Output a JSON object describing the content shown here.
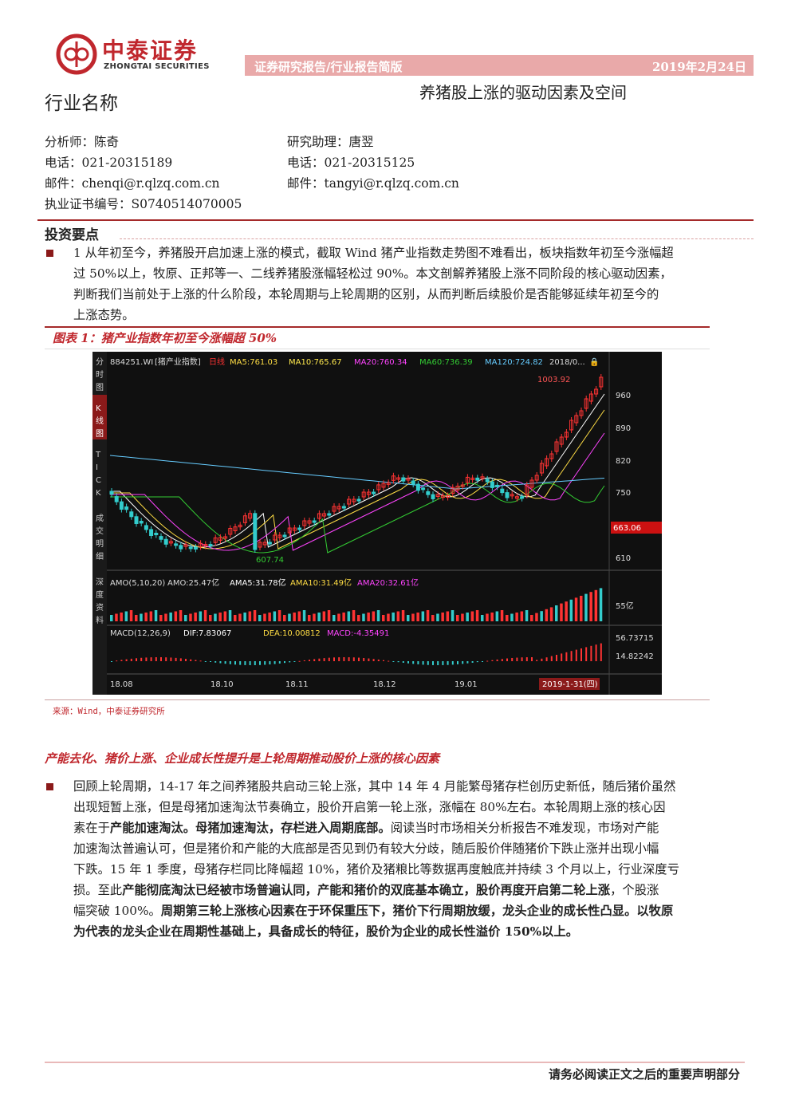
{
  "header": {
    "brand_cn": "中泰证券",
    "brand_en": "ZHONGTAI SECURITIES",
    "bar_left": "证券研究报告/行业报告简版",
    "bar_right": "2019年2月24日",
    "industry_name": "行业名称",
    "report_title": "养猪股上涨的驱动因素及空间"
  },
  "analysts": {
    "a1_name": "分析师：陈奇",
    "a1_phone": "电话：021-20315189",
    "a1_email": "邮件：chenqi@r.qlzq.com.cn",
    "a1_cert": "执业证书编号：S0740514070005",
    "a2_name": "研究助理：唐翌",
    "a2_phone": "电话：021-20315125",
    "a2_email": "邮件：tangyi@r.qlzq.com.cn"
  },
  "section": {
    "title": "投资要点"
  },
  "para1": {
    "l1": "1 从年初至今，养猪股开启加速上涨的模式，截取 Wind 猪产业指数走势图不难看出，板块指数年初至今涨幅超",
    "l2": "过 50%以上，牧原、正邦等一、二线养猪股涨幅轻松过 90%。本文剖解养猪股上涨不同阶段的核心驱动因素，",
    "l3": "判断我们当前处于上涨的什么阶段，本轮周期与上轮周期的区别，从而判断后续股价是否能够延续年初至今的",
    "l4": "上涨态势。"
  },
  "figure": {
    "title": "图表 1：猪产业指数年初至今涨幅超 50%",
    "source": "来源：Wind，中泰证券研究所"
  },
  "chart_text": {
    "left_tabs": [
      "分时图",
      "K线图",
      "TICK",
      "成交明细",
      "深度资料"
    ],
    "code": "884251.WI",
    "name": "[猪产业指数]",
    "period": "日线",
    "ma5": "MA5:761.03",
    "ma10": "MA10:765.67",
    "ma20": "MA20:760.34",
    "ma60": "MA60:736.39",
    "ma120": "MA120:724.82",
    "date_tag": "2018/0...",
    "high_label": "1003.92",
    "low_label": "607.74",
    "price_axis": [
      "960",
      "890",
      "820",
      "750",
      "610"
    ],
    "current_price": "663.06",
    "amo_title": "AMO(5,10,20)",
    "amo": "AMO:25.47亿",
    "ama5": "AMA5:31.78亿",
    "ama10": "AMA10:31.49亿",
    "ama20": "AMA20:32.61亿",
    "amo_axis": "55亿",
    "macd_title": "MACD(12,26,9)",
    "dif": "DIF:7.83067",
    "dea": "DEA:10.00812",
    "macd": "MACD:-4.35491",
    "macd_axis": [
      "56.73715",
      "14.82242"
    ],
    "dates": [
      "18.08",
      "18.10",
      "18.11",
      "18.12",
      "19.01"
    ],
    "cursor_date": "2019-1-31(四)"
  },
  "sub_heading": "产能去化、猪价上涨、企业成长性提升是上轮周期推动股价上涨的核心因素",
  "para2": {
    "l1": "回顾上轮周期，14-17 年之间养猪股共启动三轮上涨，其中 14 年 4 月能繁母猪存栏创历史新低，随后猪价虽然",
    "l2": "出现短暂上涨，但是母猪加速淘汰节奏确立，股价开启第一轮上涨，涨幅在 80%左右。本轮周期上涨的核心因",
    "l3a": "素在于",
    "l3b": "产能加速淘汰。母猪加速淘汰，存栏进入周期底部。",
    "l3c": "阅读当时市场相关分析报告不难发现，市场对产能",
    "l4": "加速淘汰普遍认可，但是猪价和产能的大底部是否见到仍有较大分歧，随后股价伴随猪价下跌止涨并出现小幅",
    "l5": "下跌。15 年 1 季度，母猪存栏同比降幅超 10%，猪价及猪粮比等数据再度触底并持续 3 个月以上，行业深度亏",
    "l6a": "损。至此",
    "l6b": "产能彻底淘汰已经被市场普遍认同，产能和猪价的双底基本确立，股价再度开启第二轮上涨",
    "l6c": "，个股涨",
    "l7a": "幅突破 100%。",
    "l7b": "周期第三轮上涨核心因素在于环保重压下，猪价下行周期放缓，龙头企业的成长性凸显。以牧原",
    "l8": "为代表的龙头企业在周期性基础上，具备成长的特征，股价为企业的成长性溢价 150%以上。"
  },
  "footer": {
    "text": "请务必阅读正文之后的重要声明部分"
  }
}
